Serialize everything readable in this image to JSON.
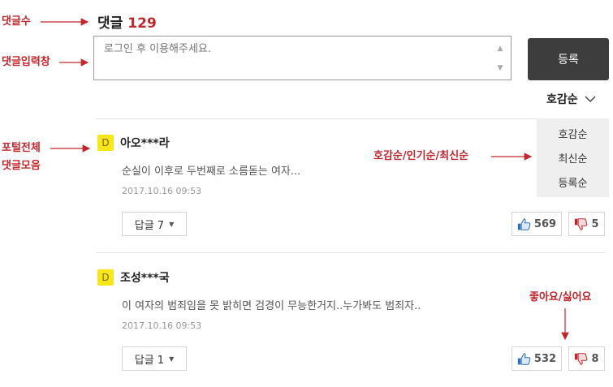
{
  "annotations": {
    "count": "댓글수",
    "input": "댓글입력창",
    "all_comments": "포털전체\n댓글모음",
    "sort_options": "호감순/인기순/최신순",
    "like_dislike": "좋아요/싫어요"
  },
  "header": {
    "label": "댓글",
    "count": "129"
  },
  "input": {
    "placeholder": "로그인 후 이용해주세요."
  },
  "submit": {
    "label": "등록"
  },
  "sort": {
    "current": "호감순",
    "options": [
      "호감순",
      "최신순",
      "등록순"
    ]
  },
  "comments": [
    {
      "avatar": "D",
      "user": "아오***라",
      "text": "순실이 이후로 두번째로 소름돋는 여자...",
      "time": "2017.10.16 09:53",
      "reply_label": "답글 7",
      "likes": "569",
      "dislikes": "5"
    },
    {
      "avatar": "D",
      "user": "조성***국",
      "text": "이 여자의 범죄임을 못 밝히면 검경이 무능한거지..누가봐도 범죄자..",
      "time": "2017.10.16 09:53",
      "reply_label": "답글 1",
      "likes": "532",
      "dislikes": "8"
    }
  ],
  "colors": {
    "accent": "#c0282e",
    "avatar": "#f6e61a",
    "button_dark": "#3d3d3d",
    "like": "#2f6fb3",
    "dislike": "#c0282e"
  },
  "icons": {
    "like": "thumbs-up-icon",
    "dislike": "thumbs-down-icon",
    "caret": "caret-down-icon",
    "sort_chevron": "chevron-down-icon"
  }
}
